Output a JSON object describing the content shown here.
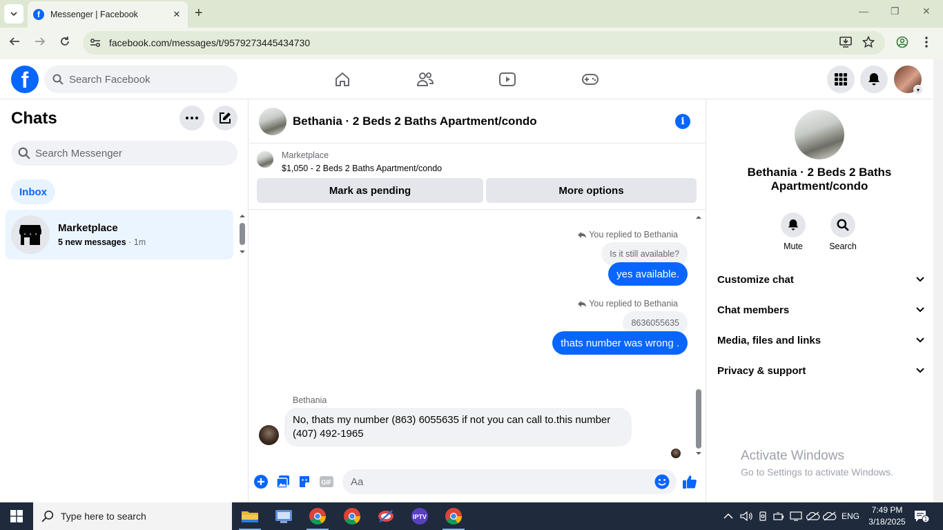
{
  "browser": {
    "tab_title": "Messenger | Facebook",
    "url": "facebook.com/messages/t/9579273445434730"
  },
  "fb": {
    "search_placeholder": "Search Facebook"
  },
  "chats": {
    "title": "Chats",
    "search_placeholder": "Search Messenger",
    "filter_inbox": "Inbox",
    "items": [
      {
        "name": "Marketplace",
        "sub_bold": "5 new messages",
        "sub_time": " · 1m"
      }
    ]
  },
  "conversation": {
    "title": "Bethania · 2 Beds 2 Baths Apartment/condo",
    "marketplace_label": "Marketplace",
    "listing": "$1,050 - 2 Beds 2 Baths Apartment/condo",
    "btn_pending": "Mark as pending",
    "btn_more": "More options",
    "messages": [
      {
        "replied": "You replied to Bethania",
        "quoted": "Is it still available?",
        "text": "yes available."
      },
      {
        "replied": "You replied to Bethania",
        "quoted": "8636055635",
        "text": "thats number was wrong ."
      },
      {
        "sender": "Bethania",
        "text_line1": "No, thats my number (863) 6055635 if not you can call to.this number",
        "text_line2": "(407) 492-1965"
      }
    ],
    "composer_placeholder": "Aa"
  },
  "details": {
    "name": "Bethania · 2 Beds 2 Baths Apartment/condo",
    "actions": [
      {
        "label": "Mute"
      },
      {
        "label": "Search"
      }
    ],
    "sections": [
      "Customize chat",
      "Chat members",
      "Media, files and links",
      "Privacy & support"
    ]
  },
  "watermark": {
    "line1": "Activate Windows",
    "line2": "Go to Settings to activate Windows."
  },
  "taskbar": {
    "search_placeholder": "Type here to search",
    "lang": "ENG",
    "time": "7:49 PM",
    "date": "3/18/2025",
    "notif_count": "1"
  },
  "colors": {
    "accent": "#0866ff",
    "bubble_in": "#f0f2f5",
    "chrome": "#dde7d2"
  }
}
